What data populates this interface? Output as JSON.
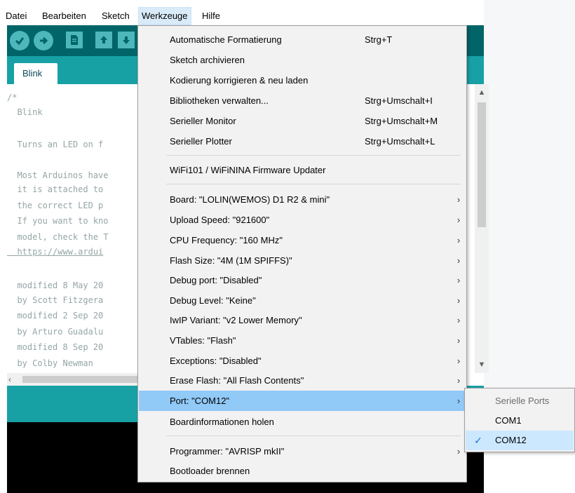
{
  "menubar": {
    "items": [
      {
        "label": "Datei"
      },
      {
        "label": "Bearbeiten"
      },
      {
        "label": "Sketch"
      },
      {
        "label": "Werkzeuge"
      },
      {
        "label": "Hilfe"
      }
    ]
  },
  "toolbar": {
    "icons": [
      "verify-icon",
      "upload-icon",
      "new-icon",
      "open-icon",
      "save-icon"
    ]
  },
  "tab": {
    "label": "Blink"
  },
  "editor": {
    "lines": [
      "/*",
      "  Blink",
      "",
      "  Turns an LED on f",
      "",
      "  Most Arduinos have",
      "  it is attached to",
      "  the correct LED p",
      "  If you want to kno",
      "  model, check the T",
      "  https://www.ardui",
      "",
      "  modified 8 May 20",
      "  by Scott Fitzgera",
      "  modified 2 Sep 20",
      "  by Arturo Guadalu",
      "  modified 8 Sep 20",
      "  by Colby Newman"
    ]
  },
  "menu": {
    "items": [
      {
        "label": "Automatische Formatierung",
        "shortcut": "Strg+T"
      },
      {
        "label": "Sketch archivieren",
        "shortcut": ""
      },
      {
        "label": "Kodierung korrigieren & neu laden",
        "shortcut": ""
      },
      {
        "label": "Bibliotheken verwalten...",
        "shortcut": "Strg+Umschalt+I"
      },
      {
        "label": "Serieller Monitor",
        "shortcut": "Strg+Umschalt+M"
      },
      {
        "label": "Serieller Plotter",
        "shortcut": "Strg+Umschalt+L"
      },
      {
        "label": "WiFi101 / WiFiNINA Firmware Updater",
        "shortcut": ""
      },
      {
        "label": "Board: \"LOLIN(WEMOS) D1 R2 & mini\"",
        "shortcut": ""
      },
      {
        "label": "Upload Speed: \"921600\"",
        "shortcut": ""
      },
      {
        "label": "CPU Frequency: \"160 MHz\"",
        "shortcut": ""
      },
      {
        "label": "Flash Size: \"4M (1M SPIFFS)\"",
        "shortcut": ""
      },
      {
        "label": "Debug port: \"Disabled\"",
        "shortcut": ""
      },
      {
        "label": "Debug Level: \"Keine\"",
        "shortcut": ""
      },
      {
        "label": "IwIP Variant: \"v2 Lower Memory\"",
        "shortcut": ""
      },
      {
        "label": "VTables: \"Flash\"",
        "shortcut": ""
      },
      {
        "label": "Exceptions: \"Disabled\"",
        "shortcut": ""
      },
      {
        "label": "Erase Flash: \"All Flash Contents\"",
        "shortcut": ""
      },
      {
        "label": "Port: \"COM12\"",
        "shortcut": ""
      },
      {
        "label": "Boardinformationen holen",
        "shortcut": ""
      },
      {
        "label": "Programmer: \"AVRISP mkII\"",
        "shortcut": ""
      },
      {
        "label": "Bootloader brennen",
        "shortcut": ""
      }
    ]
  },
  "submenu": {
    "header": "Serielle Ports",
    "items": [
      {
        "label": "COM1",
        "checked": false
      },
      {
        "label": "COM12",
        "checked": true
      }
    ]
  },
  "colors": {
    "toolbar": "#006468",
    "tabbar": "#17a1a5",
    "menu_highlight": "#91c9f7",
    "toolbar_button": "#4db7bb"
  }
}
